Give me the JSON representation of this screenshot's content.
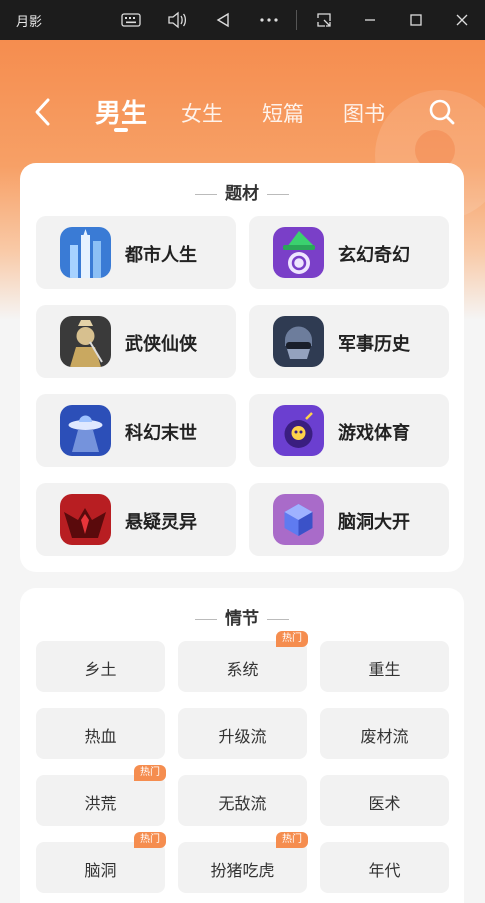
{
  "window": {
    "title": "月影",
    "buttons": [
      "keyboard-icon",
      "volume-icon",
      "back-triangle-icon",
      "more-icon",
      "screenshot-icon",
      "minimize-icon",
      "maximize-icon",
      "close-icon"
    ]
  },
  "header": {
    "tabs": [
      {
        "label": "男生",
        "active": true
      },
      {
        "label": "女生",
        "active": false
      },
      {
        "label": "短篇",
        "active": false
      },
      {
        "label": "图书",
        "active": false
      }
    ]
  },
  "themes": {
    "title": "题材",
    "items": [
      {
        "label": "都市人生",
        "icon": "city-buildings-icon",
        "color": "#3a7bd5"
      },
      {
        "label": "玄幻奇幻",
        "icon": "wizard-hat-icon",
        "color": "#7a3fc8"
      },
      {
        "label": "武侠仙侠",
        "icon": "swordsman-icon",
        "color": "#3a3a3a"
      },
      {
        "label": "军事历史",
        "icon": "soldier-helmet-icon",
        "color": "#2f3b52"
      },
      {
        "label": "科幻末世",
        "icon": "ufo-icon",
        "color": "#2c4fb8"
      },
      {
        "label": "游戏体育",
        "icon": "skull-bomb-icon",
        "color": "#6b3fd0"
      },
      {
        "label": "悬疑灵异",
        "icon": "demon-icon",
        "color": "#b81e22"
      },
      {
        "label": "脑洞大开",
        "icon": "cube-icon",
        "color": "#a96bc9"
      }
    ]
  },
  "plots": {
    "title": "情节",
    "hot_label": "热门",
    "items": [
      {
        "label": "乡土",
        "hot": false
      },
      {
        "label": "系统",
        "hot": true
      },
      {
        "label": "重生",
        "hot": false
      },
      {
        "label": "热血",
        "hot": false
      },
      {
        "label": "升级流",
        "hot": false
      },
      {
        "label": "废材流",
        "hot": false
      },
      {
        "label": "洪荒",
        "hot": true
      },
      {
        "label": "无敌流",
        "hot": false
      },
      {
        "label": "医术",
        "hot": false
      },
      {
        "label": "脑洞",
        "hot": true
      },
      {
        "label": "扮猪吃虎",
        "hot": true
      },
      {
        "label": "年代",
        "hot": false
      }
    ]
  }
}
